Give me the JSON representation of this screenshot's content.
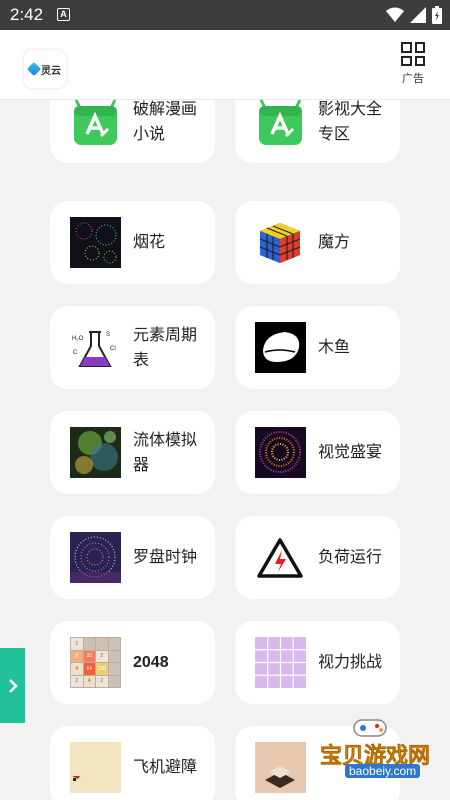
{
  "status_bar": {
    "time": "2:42",
    "notification_icon": "A"
  },
  "app_bar": {
    "logo_text": "灵云",
    "ad_label": "广告"
  },
  "cards": [
    {
      "title": "破解漫画小说",
      "icon": "android-app-icon"
    },
    {
      "title": "影视大全专区",
      "icon": "android-app-icon"
    },
    {
      "title": "烟花",
      "icon": "fireworks-icon"
    },
    {
      "title": "魔方",
      "icon": "rubiks-cube-icon"
    },
    {
      "title": "元素周期表",
      "icon": "chemistry-flask-icon"
    },
    {
      "title": "木鱼",
      "icon": "wooden-fish-icon"
    },
    {
      "title": "流体模拟器",
      "icon": "fluid-icon"
    },
    {
      "title": "视觉盛宴",
      "icon": "particle-sphere-icon"
    },
    {
      "title": "罗盘时钟",
      "icon": "compass-clock-icon"
    },
    {
      "title": "负荷运行",
      "icon": "warning-icon"
    },
    {
      "title": "2048",
      "icon": "2048-grid-icon"
    },
    {
      "title": "视力挑战",
      "icon": "color-grid-icon"
    },
    {
      "title": "飞机避障",
      "icon": "plane-icon"
    },
    {
      "title": "",
      "icon": "stack-tower-icon"
    }
  ],
  "tile_2048": [
    "2",
    "",
    "",
    "",
    "8",
    "32",
    "2",
    "",
    "4",
    "64",
    "128",
    "",
    "2",
    "4",
    "2",
    ""
  ],
  "watermark": {
    "text": "宝贝游戏网",
    "url": "baobeiy.com"
  },
  "colors": {
    "accent": "#21c29a",
    "android_green": "#3ec95c",
    "status_bar": "#3d3d3d"
  }
}
